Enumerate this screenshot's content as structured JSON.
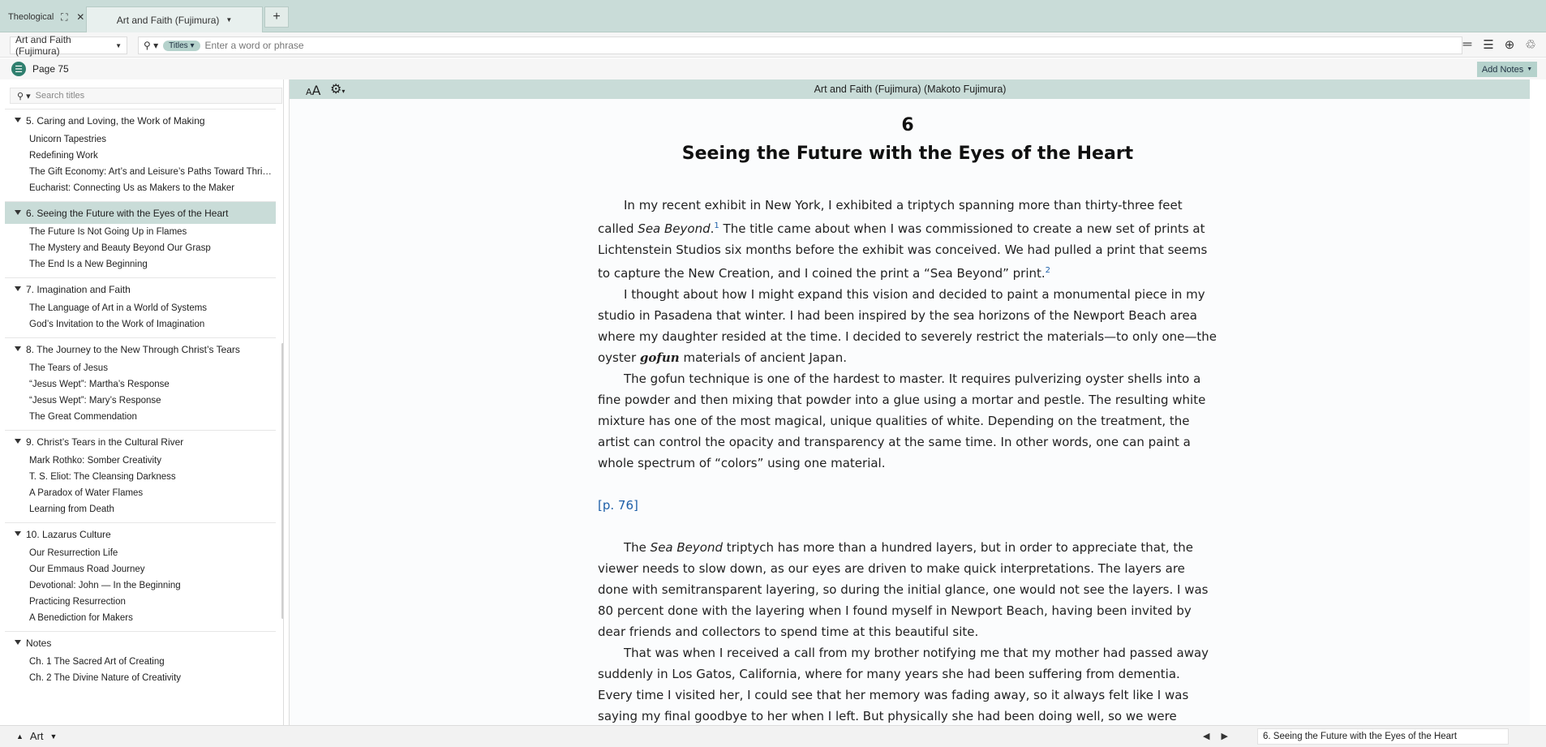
{
  "tabs": {
    "group_label": "Theological",
    "active_tab": "Art and Faith (Fujimura)",
    "add_label": "+"
  },
  "toolbar": {
    "resource": "Art and Faith (Fujimura)",
    "search_mode": "Titles",
    "search_placeholder": "Enter a word or phrase"
  },
  "pagestrip": {
    "page": "Page 75",
    "add_notes": "Add Notes"
  },
  "sidebar": {
    "search_placeholder": "Search titles",
    "chapters": [
      {
        "title": "5. Caring and Loving, the Work of Making",
        "selected": false,
        "sections": [
          "Unicorn Tapestries",
          "Redefining Work",
          "The Gift Economy: Art’s and Leisure’s Paths Toward Thri…",
          "Eucharist: Connecting Us as Makers to the Maker"
        ]
      },
      {
        "title": "6. Seeing the Future with the Eyes of the Heart",
        "selected": true,
        "sections": [
          "The Future Is Not Going Up in Flames",
          "The Mystery and Beauty Beyond Our Grasp",
          "The End Is a New Beginning"
        ]
      },
      {
        "title": "7. Imagination and Faith",
        "selected": false,
        "sections": [
          "The Language of Art in a World of Systems",
          "God’s Invitation to the Work of Imagination"
        ]
      },
      {
        "title": "8. The Journey to the New Through Christ’s Tears",
        "selected": false,
        "sections": [
          "The Tears of Jesus",
          "“Jesus Wept”: Martha’s Response",
          "“Jesus Wept”: Mary’s Response",
          "The Great Commendation"
        ]
      },
      {
        "title": "9. Christ’s Tears in the Cultural River",
        "selected": false,
        "sections": [
          "Mark Rothko: Somber Creativity",
          "T. S. Eliot: The Cleansing Darkness",
          "A Paradox of Water Flames",
          "Learning from Death"
        ]
      },
      {
        "title": "10. Lazarus Culture",
        "selected": false,
        "sections": [
          "Our Resurrection Life",
          "Our Emmaus Road Journey",
          "Devotional: John — In the Beginning",
          "Practicing Resurrection",
          "A Benediction for Makers"
        ]
      },
      {
        "title": "Notes",
        "selected": false,
        "sections": [
          "Ch. 1 The Sacred Art of Creating",
          "Ch. 2 The Divine Nature of Creativity"
        ]
      }
    ]
  },
  "reader": {
    "header_title": "Art and Faith (Fujimura) (Makoto Fujimura)",
    "chapter_number": "6",
    "chapter_title": "Seeing the Future with the Eyes of the Heart",
    "p1_a": "In my recent exhibit in New York, I exhibited a triptych spanning more than thirty-three feet called ",
    "p1_em": "Sea Beyond",
    "p1_fn1": "1",
    "p1_b": " The title came about when I was commissioned to create a new set of prints at Lichtenstein Studios six months before the exhibit was conceived. We had pulled a print that seems to capture the New Creation, and I coined the print a “Sea Beyond” print.",
    "p1_fn2": "2",
    "p2_a": "I thought about how I might expand this vision and decided to paint a monumental piece in my studio in Pasadena that winter. I had been inspired by the sea horizons of the Newport Beach area where my daughter resided at the time. I decided to severely restrict the materials—to only one—the oyster ",
    "p2_em": "gofun",
    "p2_b": " materials of ancient Japan.",
    "p3": "The gofun technique is one of the hardest to master. It requires pulverizing oyster shells into a fine powder and then mixing that powder into a glue using a mortar and pestle. The resulting white mixture has one of the most magical, unique qualities of white. Depending on the treatment, the artist can control the opacity and transparency at the same time. In other words, one can paint a whole spectrum of “colors” using one material.",
    "page_marker": "[p. 76]",
    "p4_a": "The ",
    "p4_em": "Sea Beyond",
    "p4_b": " triptych has more than a hundred layers, but in order to appreciate that, the viewer needs to slow down, as our eyes are driven to make quick interpretations. The layers are done with semitransparent layering, so during the initial glance, one would not see the layers. I was 80 percent done with the layering when I found myself in Newport Beach, having been invited by dear friends and collectors to spend time at this beautiful site.",
    "p5": "That was when I received a call from my brother notifying me that my mother had passed away suddenly in Los Gatos, California, where for many years she had been suffering from dementia. Every time I visited her, I could see that her memory was fading away, so it always felt like I was saying my final goodbye to her when I left. But physically she had been doing well, so we were surprised that God had"
  },
  "statusbar": {
    "layout_name": "Art",
    "current_section": "6. Seeing the Future with the Eyes of the Heart"
  },
  "colors": {
    "accent": "#c9dcd8",
    "link": "#1d5fa8",
    "toc_button": "#2f7f6e"
  }
}
